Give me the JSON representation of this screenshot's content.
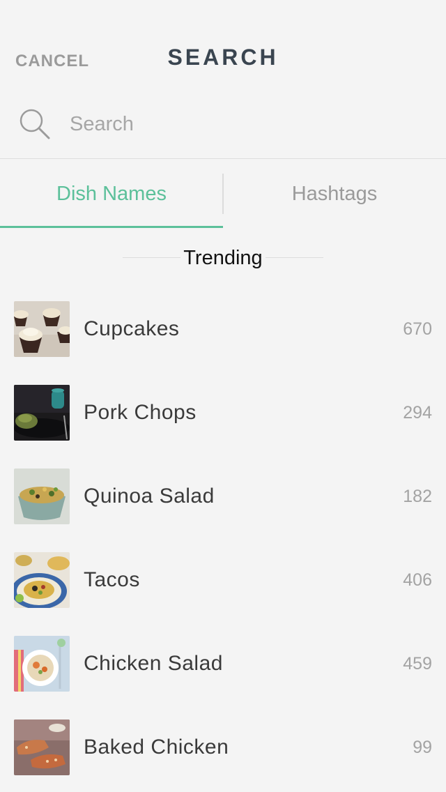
{
  "nav": {
    "cancel_label": "CANCEL",
    "title": "SEARCH"
  },
  "search": {
    "placeholder": "Search",
    "icon": "search-icon"
  },
  "tabs": [
    {
      "label": "Dish Names",
      "active": true
    },
    {
      "label": "Hashtags",
      "active": false
    }
  ],
  "section": {
    "title": "Trending"
  },
  "dishes": [
    {
      "name": "Cupcakes",
      "count": "670"
    },
    {
      "name": "Pork Chops",
      "count": "294"
    },
    {
      "name": "Quinoa Salad",
      "count": "182"
    },
    {
      "name": "Tacos",
      "count": "406"
    },
    {
      "name": "Chicken Salad",
      "count": "459"
    },
    {
      "name": "Baked Chicken",
      "count": "99"
    }
  ],
  "colors": {
    "accent": "#5cc09a",
    "background": "#f4f4f4",
    "title": "#3a4550"
  }
}
